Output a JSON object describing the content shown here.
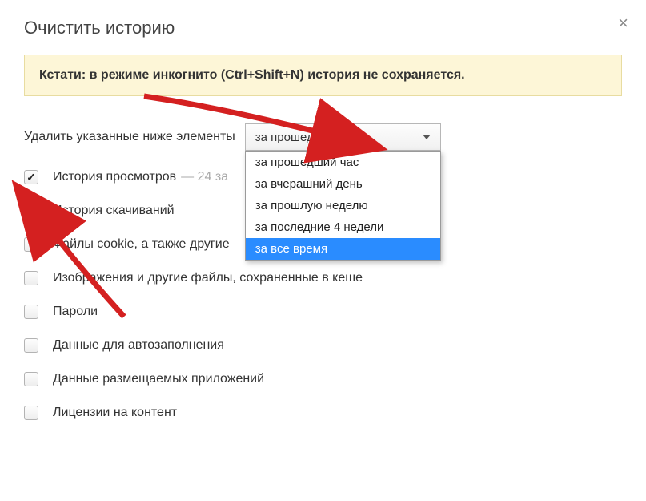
{
  "title": "Очистить историю",
  "info": {
    "prefix": "Кстати:",
    "rest": " в режиме инкогнито (Ctrl+Shift+N) история не сохраняется."
  },
  "delete_label": "Удалить указанные ниже элементы",
  "select": {
    "selected": "за прошедший час",
    "options": [
      "за прошедший час",
      "за вчерашний день",
      "за прошлую неделю",
      "за последние 4 недели",
      "за все время"
    ],
    "highlighted_index": 4
  },
  "checks": [
    {
      "label": "История просмотров",
      "checked": true,
      "suffix": " —  24 за"
    },
    {
      "label": "История скачиваний",
      "checked": true,
      "suffix": ""
    },
    {
      "label": "Файлы cookie, а также другие ",
      "checked": false,
      "suffix": ""
    },
    {
      "label": "Изображения и другие файлы, сохраненные в кеше",
      "checked": false,
      "suffix": ""
    },
    {
      "label": "Пароли",
      "checked": false,
      "suffix": ""
    },
    {
      "label": "Данные для автозаполнения",
      "checked": false,
      "suffix": ""
    },
    {
      "label": "Данные размещаемых приложений",
      "checked": false,
      "suffix": ""
    },
    {
      "label": "Лицензии на контент",
      "checked": false,
      "suffix": ""
    }
  ]
}
